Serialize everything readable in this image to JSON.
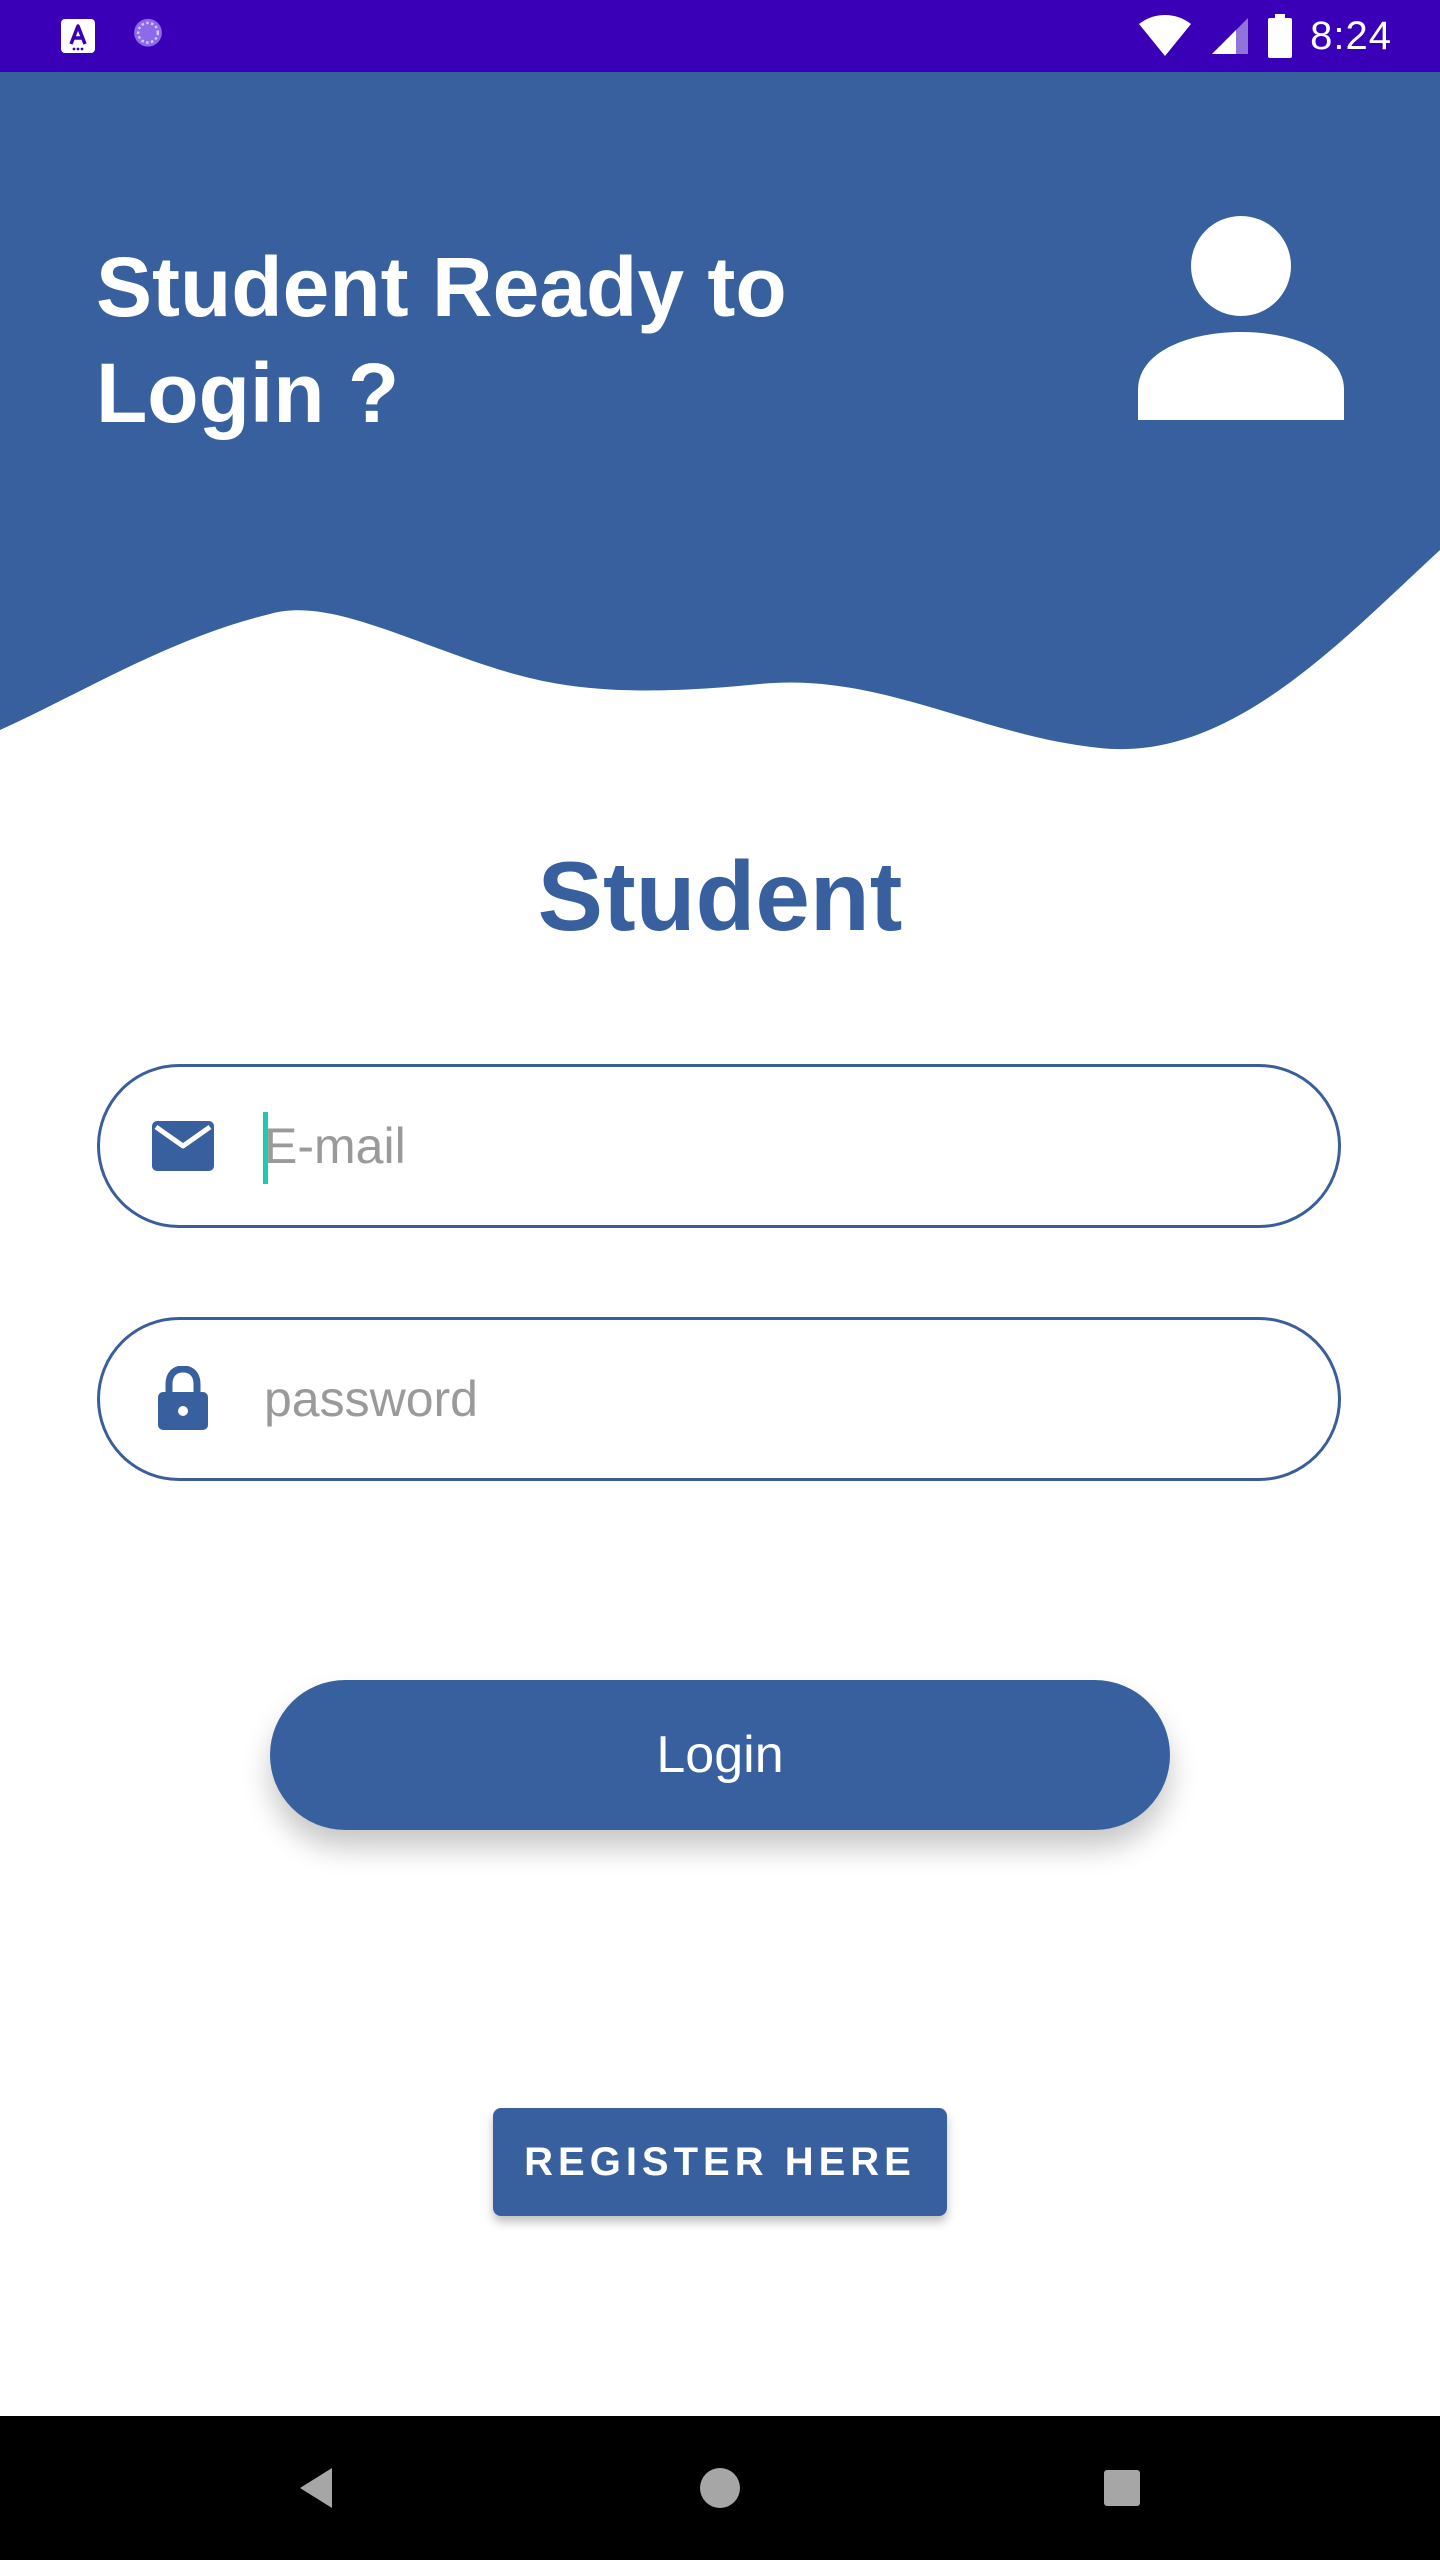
{
  "status_bar": {
    "time": "8:24",
    "background": "#3a00b8",
    "icons": [
      "app-notification-icon",
      "loading-icon",
      "wifi-icon",
      "cellular-signal-icon",
      "battery-icon"
    ]
  },
  "header": {
    "title": "Student Ready to\nLogin ?",
    "background": "#38609e",
    "icon": "person-icon"
  },
  "main": {
    "heading": "Student",
    "heading_color": "#38609e",
    "email_field": {
      "value": "",
      "placeholder": "E-mail",
      "icon": "mail-icon"
    },
    "password_field": {
      "value": "",
      "placeholder": "password",
      "icon": "lock-icon"
    },
    "login_button": "Login",
    "register_button": "REGISTER HERE",
    "accent_color": "#38609e"
  },
  "nav_bar": {
    "buttons": [
      "back-icon",
      "home-icon",
      "recents-icon"
    ]
  }
}
